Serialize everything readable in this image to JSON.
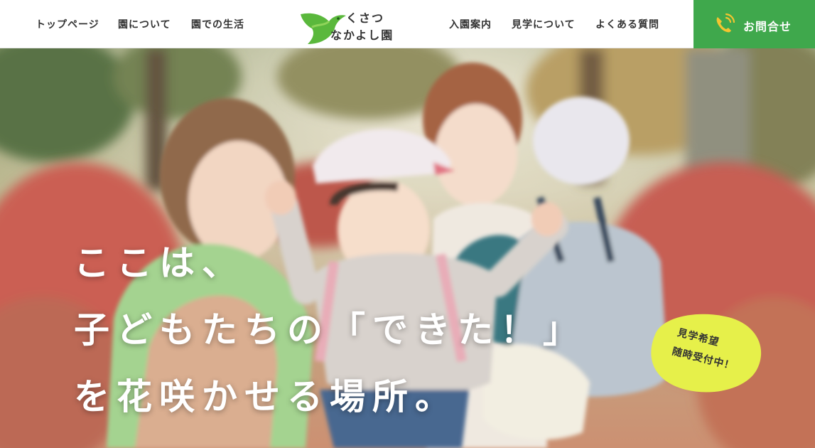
{
  "header": {
    "nav_left": [
      "トップページ",
      "園について",
      "園での生活"
    ],
    "logo": {
      "line1": "くさつ",
      "line2": "なかよし園",
      "icon": "green-bird-logo",
      "color": "#5ab83c"
    },
    "nav_right": [
      "入園案内",
      "見学について",
      "よくある質問"
    ],
    "contact": {
      "label": "お問合せ",
      "icon": "phone-icon",
      "bg_color": "#3fa84c"
    }
  },
  "hero": {
    "headline": [
      "ここは、",
      "子どもたちの「できた！」",
      "を花咲かせる場所。"
    ],
    "badge": {
      "line1": "見学希望",
      "line2": "随時受付中！",
      "color": "#e6f04a"
    }
  }
}
